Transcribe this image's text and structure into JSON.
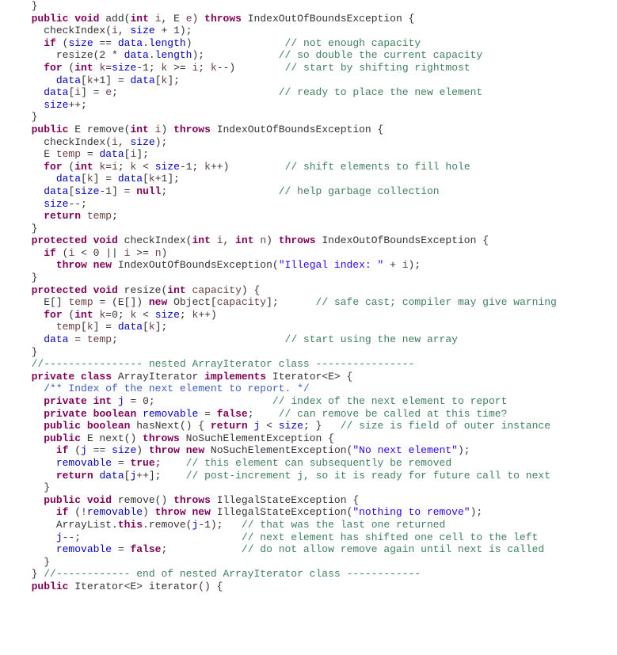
{
  "lines": [
    {
      "indent": 2,
      "segs": [
        {
          "t": "}",
          "c": ""
        }
      ]
    },
    {
      "indent": 2,
      "segs": [
        {
          "t": "public",
          "c": "k"
        },
        {
          "t": " "
        },
        {
          "t": "void",
          "c": "k"
        },
        {
          "t": " add("
        },
        {
          "t": "int",
          "c": "k"
        },
        {
          "t": " "
        },
        {
          "t": "i",
          "c": "par"
        },
        {
          "t": ", E "
        },
        {
          "t": "e",
          "c": "par"
        },
        {
          "t": ") "
        },
        {
          "t": "throws",
          "c": "k"
        },
        {
          "t": " IndexOutOfBoundsException {"
        }
      ]
    },
    {
      "indent": 4,
      "segs": [
        {
          "t": "checkIndex("
        },
        {
          "t": "i",
          "c": "par"
        },
        {
          "t": ", "
        },
        {
          "t": "size",
          "c": "fld"
        },
        {
          "t": " + 1);"
        }
      ]
    },
    {
      "indent": 4,
      "segs": [
        {
          "t": "if",
          "c": "k"
        },
        {
          "t": " ("
        },
        {
          "t": "size",
          "c": "fld"
        },
        {
          "t": " == "
        },
        {
          "t": "data",
          "c": "fld"
        },
        {
          "t": "."
        },
        {
          "t": "length",
          "c": "fld"
        },
        {
          "t": ")"
        },
        {
          "pad": 15
        },
        {
          "t": "// not enough capacity",
          "c": "com"
        }
      ]
    },
    {
      "indent": 6,
      "segs": [
        {
          "t": "resize(2 * "
        },
        {
          "t": "data",
          "c": "fld"
        },
        {
          "t": "."
        },
        {
          "t": "length",
          "c": "fld"
        },
        {
          "t": ");"
        },
        {
          "pad": 12
        },
        {
          "t": "// so double the current capacity",
          "c": "com"
        }
      ]
    },
    {
      "indent": 4,
      "segs": [
        {
          "t": "for",
          "c": "k"
        },
        {
          "t": " ("
        },
        {
          "t": "int",
          "c": "k"
        },
        {
          "t": " "
        },
        {
          "t": "k",
          "c": "par"
        },
        {
          "t": "="
        },
        {
          "t": "size",
          "c": "fld"
        },
        {
          "t": "-1; "
        },
        {
          "t": "k",
          "c": "par"
        },
        {
          "t": " >= "
        },
        {
          "t": "i",
          "c": "par"
        },
        {
          "t": "; "
        },
        {
          "t": "k",
          "c": "par"
        },
        {
          "t": "--)"
        },
        {
          "pad": 8
        },
        {
          "t": "// start by shifting rightmost",
          "c": "com"
        }
      ]
    },
    {
      "indent": 6,
      "segs": [
        {
          "t": "data",
          "c": "fld"
        },
        {
          "t": "["
        },
        {
          "t": "k",
          "c": "par"
        },
        {
          "t": "+1] = "
        },
        {
          "t": "data",
          "c": "fld"
        },
        {
          "t": "["
        },
        {
          "t": "k",
          "c": "par"
        },
        {
          "t": "];"
        }
      ]
    },
    {
      "indent": 4,
      "segs": [
        {
          "t": "data",
          "c": "fld"
        },
        {
          "t": "["
        },
        {
          "t": "i",
          "c": "par"
        },
        {
          "t": "] = "
        },
        {
          "t": "e",
          "c": "par"
        },
        {
          "t": ";"
        },
        {
          "pad": 26
        },
        {
          "t": "// ready to place the new element",
          "c": "com"
        }
      ]
    },
    {
      "indent": 4,
      "segs": [
        {
          "t": "size",
          "c": "fld"
        },
        {
          "t": "++;"
        }
      ]
    },
    {
      "indent": 2,
      "segs": [
        {
          "t": "}"
        }
      ]
    },
    {
      "indent": 2,
      "segs": [
        {
          "t": "public",
          "c": "k"
        },
        {
          "t": " E remove("
        },
        {
          "t": "int",
          "c": "k"
        },
        {
          "t": " "
        },
        {
          "t": "i",
          "c": "par"
        },
        {
          "t": ") "
        },
        {
          "t": "throws",
          "c": "k"
        },
        {
          "t": " IndexOutOfBoundsException {"
        }
      ]
    },
    {
      "indent": 4,
      "segs": [
        {
          "t": "checkIndex("
        },
        {
          "t": "i",
          "c": "par"
        },
        {
          "t": ", "
        },
        {
          "t": "size",
          "c": "fld"
        },
        {
          "t": ");"
        }
      ]
    },
    {
      "indent": 4,
      "segs": [
        {
          "t": "E "
        },
        {
          "t": "temp",
          "c": "par"
        },
        {
          "t": " = "
        },
        {
          "t": "data",
          "c": "fld"
        },
        {
          "t": "["
        },
        {
          "t": "i",
          "c": "par"
        },
        {
          "t": "];"
        }
      ]
    },
    {
      "indent": 4,
      "segs": [
        {
          "t": "for",
          "c": "k"
        },
        {
          "t": " ("
        },
        {
          "t": "int",
          "c": "k"
        },
        {
          "t": " "
        },
        {
          "t": "k",
          "c": "par"
        },
        {
          "t": "="
        },
        {
          "t": "i",
          "c": "par"
        },
        {
          "t": "; "
        },
        {
          "t": "k",
          "c": "par"
        },
        {
          "t": " < "
        },
        {
          "t": "size",
          "c": "fld"
        },
        {
          "t": "-1; "
        },
        {
          "t": "k",
          "c": "par"
        },
        {
          "t": "++)"
        },
        {
          "pad": 9
        },
        {
          "t": "// shift elements to fill hole",
          "c": "com"
        }
      ]
    },
    {
      "indent": 6,
      "segs": [
        {
          "t": "data",
          "c": "fld"
        },
        {
          "t": "["
        },
        {
          "t": "k",
          "c": "par"
        },
        {
          "t": "] = "
        },
        {
          "t": "data",
          "c": "fld"
        },
        {
          "t": "["
        },
        {
          "t": "k",
          "c": "par"
        },
        {
          "t": "+1];"
        }
      ]
    },
    {
      "indent": 4,
      "segs": [
        {
          "t": "data",
          "c": "fld"
        },
        {
          "t": "["
        },
        {
          "t": "size",
          "c": "fld"
        },
        {
          "t": "-1] = "
        },
        {
          "t": "null",
          "c": "k"
        },
        {
          "t": ";"
        },
        {
          "pad": 18
        },
        {
          "t": "// help garbage collection",
          "c": "com"
        }
      ]
    },
    {
      "indent": 4,
      "segs": [
        {
          "t": "size",
          "c": "fld"
        },
        {
          "t": "--;"
        }
      ]
    },
    {
      "indent": 4,
      "segs": [
        {
          "t": "return",
          "c": "k"
        },
        {
          "t": " "
        },
        {
          "t": "temp",
          "c": "par"
        },
        {
          "t": ";"
        }
      ]
    },
    {
      "indent": 2,
      "segs": [
        {
          "t": "}"
        }
      ]
    },
    {
      "indent": 2,
      "segs": [
        {
          "t": "protected",
          "c": "k"
        },
        {
          "t": " "
        },
        {
          "t": "void",
          "c": "k"
        },
        {
          "t": " checkIndex("
        },
        {
          "t": "int",
          "c": "k"
        },
        {
          "t": " "
        },
        {
          "t": "i",
          "c": "par"
        },
        {
          "t": ", "
        },
        {
          "t": "int",
          "c": "k"
        },
        {
          "t": " "
        },
        {
          "t": "n",
          "c": "par"
        },
        {
          "t": ") "
        },
        {
          "t": "throws",
          "c": "k"
        },
        {
          "t": " IndexOutOfBoundsException {"
        }
      ]
    },
    {
      "indent": 4,
      "segs": [
        {
          "t": "if",
          "c": "k"
        },
        {
          "t": " ("
        },
        {
          "t": "i",
          "c": "par"
        },
        {
          "t": " < 0 || "
        },
        {
          "t": "i",
          "c": "par"
        },
        {
          "t": " >= "
        },
        {
          "t": "n",
          "c": "par"
        },
        {
          "t": ")"
        }
      ]
    },
    {
      "indent": 6,
      "segs": [
        {
          "t": "throw",
          "c": "k"
        },
        {
          "t": " "
        },
        {
          "t": "new",
          "c": "k"
        },
        {
          "t": " IndexOutOfBoundsException("
        },
        {
          "t": "\"Illegal index: \"",
          "c": "str"
        },
        {
          "t": " + "
        },
        {
          "t": "i",
          "c": "par"
        },
        {
          "t": ");"
        }
      ]
    },
    {
      "indent": 2,
      "segs": [
        {
          "t": "}"
        }
      ]
    },
    {
      "indent": 2,
      "segs": [
        {
          "t": "protected",
          "c": "k"
        },
        {
          "t": " "
        },
        {
          "t": "void",
          "c": "k"
        },
        {
          "t": " resize("
        },
        {
          "t": "int",
          "c": "k"
        },
        {
          "t": " "
        },
        {
          "t": "capacity",
          "c": "par"
        },
        {
          "t": ") {"
        }
      ]
    },
    {
      "indent": 4,
      "segs": [
        {
          "t": "E[] "
        },
        {
          "t": "temp",
          "c": "par"
        },
        {
          "t": " = (E[]) "
        },
        {
          "t": "new",
          "c": "k"
        },
        {
          "t": " Object["
        },
        {
          "t": "capacity",
          "c": "par"
        },
        {
          "t": "];"
        },
        {
          "pad": 6
        },
        {
          "t": "// safe cast; compiler may give warning",
          "c": "com"
        }
      ]
    },
    {
      "indent": 4,
      "segs": [
        {
          "t": "for",
          "c": "k"
        },
        {
          "t": " ("
        },
        {
          "t": "int",
          "c": "k"
        },
        {
          "t": " "
        },
        {
          "t": "k",
          "c": "par"
        },
        {
          "t": "=0; "
        },
        {
          "t": "k",
          "c": "par"
        },
        {
          "t": " < "
        },
        {
          "t": "size",
          "c": "fld"
        },
        {
          "t": "; "
        },
        {
          "t": "k",
          "c": "par"
        },
        {
          "t": "++)"
        }
      ]
    },
    {
      "indent": 6,
      "segs": [
        {
          "t": "temp",
          "c": "par"
        },
        {
          "t": "["
        },
        {
          "t": "k",
          "c": "par"
        },
        {
          "t": "] = "
        },
        {
          "t": "data",
          "c": "fld"
        },
        {
          "t": "["
        },
        {
          "t": "k",
          "c": "par"
        },
        {
          "t": "];"
        }
      ]
    },
    {
      "indent": 4,
      "segs": [
        {
          "t": "data",
          "c": "fld"
        },
        {
          "t": " = "
        },
        {
          "t": "temp",
          "c": "par"
        },
        {
          "t": ";"
        },
        {
          "pad": 27
        },
        {
          "t": "// start using the new array",
          "c": "com"
        }
      ]
    },
    {
      "indent": 2,
      "segs": [
        {
          "t": "}"
        }
      ]
    },
    {
      "indent": 2,
      "segs": [
        {
          "t": "//---------------- nested ArrayIterator class ----------------",
          "c": "com"
        }
      ]
    },
    {
      "indent": 2,
      "segs": [
        {
          "t": "private",
          "c": "k"
        },
        {
          "t": " "
        },
        {
          "t": "class",
          "c": "k"
        },
        {
          "t": " ArrayIterator "
        },
        {
          "t": "implements",
          "c": "k"
        },
        {
          "t": " Iterator<E> {"
        }
      ]
    },
    {
      "indent": 4,
      "segs": [
        {
          "t": "/** Index of the next element to report. */",
          "c": "doc"
        }
      ]
    },
    {
      "indent": 4,
      "segs": [
        {
          "t": "private",
          "c": "k"
        },
        {
          "t": " "
        },
        {
          "t": "int",
          "c": "k"
        },
        {
          "t": " "
        },
        {
          "t": "j",
          "c": "fld"
        },
        {
          "t": " = 0;"
        },
        {
          "pad": 19
        },
        {
          "t": "// index of the next element to report",
          "c": "com"
        }
      ]
    },
    {
      "indent": 4,
      "segs": [
        {
          "t": "private",
          "c": "k"
        },
        {
          "t": " "
        },
        {
          "t": "boolean",
          "c": "k"
        },
        {
          "t": " "
        },
        {
          "t": "removable",
          "c": "fld"
        },
        {
          "t": " = "
        },
        {
          "t": "false",
          "c": "k"
        },
        {
          "t": ";"
        },
        {
          "pad": 4
        },
        {
          "t": "// can remove be called at this time?",
          "c": "com"
        }
      ]
    },
    {
      "indent": 4,
      "segs": [
        {
          "t": "public",
          "c": "k"
        },
        {
          "t": " "
        },
        {
          "t": "boolean",
          "c": "k"
        },
        {
          "t": " hasNext() { "
        },
        {
          "t": "return",
          "c": "k"
        },
        {
          "t": " "
        },
        {
          "t": "j",
          "c": "fld"
        },
        {
          "t": " < "
        },
        {
          "t": "size",
          "c": "fld"
        },
        {
          "t": "; }"
        },
        {
          "pad": 3
        },
        {
          "t": "// size is field of outer instance",
          "c": "com"
        }
      ]
    },
    {
      "indent": 4,
      "segs": [
        {
          "t": "public",
          "c": "k"
        },
        {
          "t": " E next() "
        },
        {
          "t": "throws",
          "c": "k"
        },
        {
          "t": " NoSuchElementException {"
        }
      ]
    },
    {
      "indent": 6,
      "segs": [
        {
          "t": "if",
          "c": "k"
        },
        {
          "t": " ("
        },
        {
          "t": "j",
          "c": "fld"
        },
        {
          "t": " == "
        },
        {
          "t": "size",
          "c": "fld"
        },
        {
          "t": ") "
        },
        {
          "t": "throw",
          "c": "k"
        },
        {
          "t": " "
        },
        {
          "t": "new",
          "c": "k"
        },
        {
          "t": " NoSuchElementException("
        },
        {
          "t": "\"No next element\"",
          "c": "str"
        },
        {
          "t": ");"
        }
      ]
    },
    {
      "indent": 6,
      "segs": [
        {
          "t": "removable",
          "c": "fld"
        },
        {
          "t": " = "
        },
        {
          "t": "true",
          "c": "k"
        },
        {
          "t": ";"
        },
        {
          "pad": 4
        },
        {
          "t": "// this element can subsequently be removed",
          "c": "com"
        }
      ]
    },
    {
      "indent": 6,
      "segs": [
        {
          "t": "return",
          "c": "k"
        },
        {
          "t": " "
        },
        {
          "t": "data",
          "c": "fld"
        },
        {
          "t": "["
        },
        {
          "t": "j",
          "c": "fld"
        },
        {
          "t": "++];"
        },
        {
          "pad": 4
        },
        {
          "t": "// post-increment j, so it is ready for future call to next",
          "c": "com"
        }
      ]
    },
    {
      "indent": 4,
      "segs": [
        {
          "t": "}"
        }
      ]
    },
    {
      "indent": 4,
      "segs": [
        {
          "t": "public",
          "c": "k"
        },
        {
          "t": " "
        },
        {
          "t": "void",
          "c": "k"
        },
        {
          "t": " remove() "
        },
        {
          "t": "throws",
          "c": "k"
        },
        {
          "t": " IllegalStateException {"
        }
      ]
    },
    {
      "indent": 6,
      "segs": [
        {
          "t": "if",
          "c": "k"
        },
        {
          "t": " (!"
        },
        {
          "t": "removable",
          "c": "fld"
        },
        {
          "t": ") "
        },
        {
          "t": "throw",
          "c": "k"
        },
        {
          "t": " "
        },
        {
          "t": "new",
          "c": "k"
        },
        {
          "t": " IllegalStateException("
        },
        {
          "t": "\"nothing to remove\"",
          "c": "str"
        },
        {
          "t": ");"
        }
      ]
    },
    {
      "indent": 6,
      "segs": [
        {
          "t": "ArrayList."
        },
        {
          "t": "this",
          "c": "k"
        },
        {
          "t": ".remove("
        },
        {
          "t": "j",
          "c": "fld"
        },
        {
          "t": "-1);"
        },
        {
          "pad": 3
        },
        {
          "t": "// that was the last one returned",
          "c": "com"
        }
      ]
    },
    {
      "indent": 6,
      "segs": [
        {
          "t": "j",
          "c": "fld"
        },
        {
          "t": "--;"
        },
        {
          "pad": 26
        },
        {
          "t": "// next element has shifted one cell to the left",
          "c": "com"
        }
      ]
    },
    {
      "indent": 6,
      "segs": [
        {
          "t": "removable",
          "c": "fld"
        },
        {
          "t": " = "
        },
        {
          "t": "false",
          "c": "k"
        },
        {
          "t": ";"
        },
        {
          "pad": 12
        },
        {
          "t": "// do not allow remove again until next is called",
          "c": "com"
        }
      ]
    },
    {
      "indent": 4,
      "segs": [
        {
          "t": "}"
        }
      ]
    },
    {
      "indent": 2,
      "segs": [
        {
          "t": "} "
        },
        {
          "t": "//------------ end of nested ArrayIterator class ------------",
          "c": "com"
        }
      ]
    },
    {
      "indent": 2,
      "segs": [
        {
          "t": "public",
          "c": "k"
        },
        {
          "t": " Iterator<E> iterator() {"
        }
      ]
    }
  ]
}
